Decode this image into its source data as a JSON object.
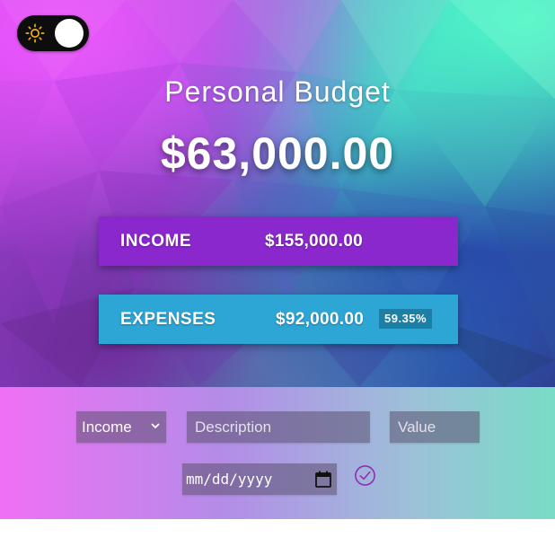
{
  "theme_toggle": {
    "icon": "sun-icon",
    "state": "light"
  },
  "header": {
    "title": "Personal Budget",
    "total": "$63,000.00"
  },
  "income": {
    "label": "INCOME",
    "amount": "$155,000.00",
    "color": "#8a27cd"
  },
  "expenses": {
    "label": "EXPENSES",
    "amount": "$92,000.00",
    "percentage": "59.35%",
    "color": "#2da6d6"
  },
  "form": {
    "type_select": {
      "selected": "Income",
      "icon": "chevron-down-icon"
    },
    "description": {
      "placeholder": "Description"
    },
    "value": {
      "placeholder": "Value"
    },
    "date": {
      "placeholder": "mm/dd/yyyy",
      "icon": "calendar-icon"
    },
    "submit": {
      "icon": "check-circle-icon",
      "color": "#8e2bb0"
    }
  }
}
